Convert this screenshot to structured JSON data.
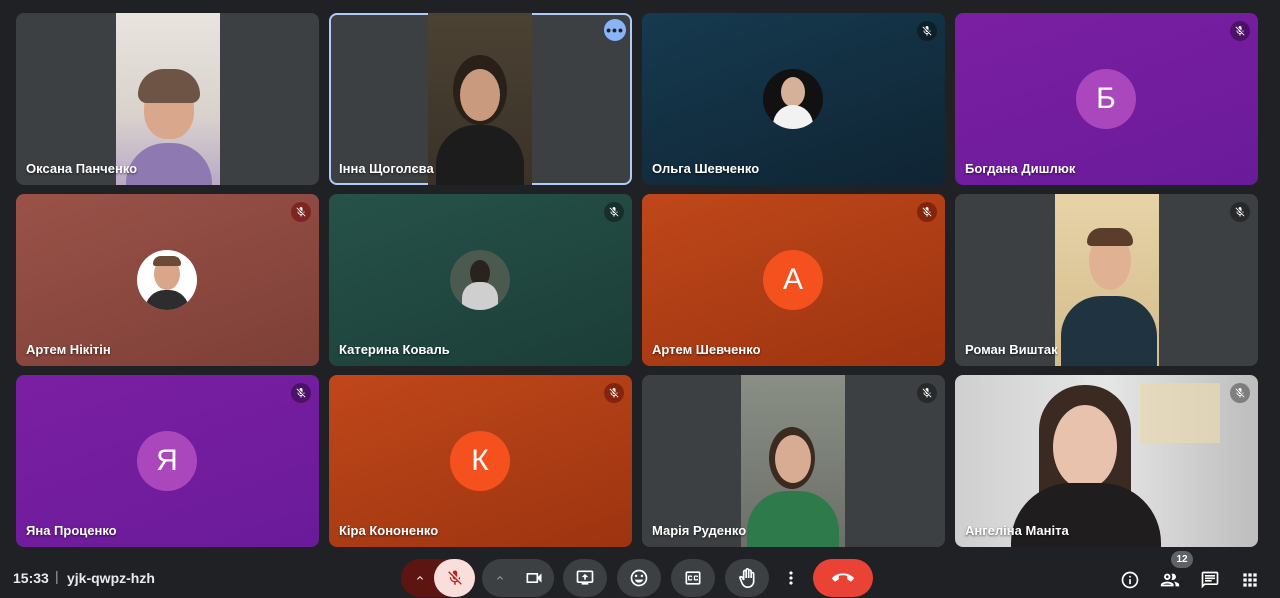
{
  "meeting": {
    "time": "15:33",
    "separator": "|",
    "code": "yjk-qwpz-hzh",
    "participants_count": "12"
  },
  "participants": [
    {
      "name": "Оксана Панченко",
      "kind": "video",
      "muted": false,
      "bg": "#3c4043"
    },
    {
      "name": "Інна Щоголєва",
      "kind": "video",
      "muted": false,
      "bg": "#3c4043",
      "active": true
    },
    {
      "name": "Ольга Шевченко",
      "kind": "photo",
      "muted": true,
      "bg": "#123043"
    },
    {
      "name": "Богдана Дишлюк",
      "kind": "letter",
      "letter": "Б",
      "muted": true,
      "bg": "#7b1fa2",
      "avatar_color": "#ab47bc"
    },
    {
      "name": "Артем Нікітін",
      "kind": "photo",
      "muted": true,
      "bg": "#8d4a43"
    },
    {
      "name": "Катерина Коваль",
      "kind": "photo",
      "muted": true,
      "bg": "#234a43"
    },
    {
      "name": "Артем Шевченко",
      "kind": "letter",
      "letter": "А",
      "muted": true,
      "bg": "#bf4012",
      "avatar_color": "#f4511e"
    },
    {
      "name": "Роман Виштак",
      "kind": "video",
      "muted": true,
      "bg": "#3c4043"
    },
    {
      "name": "Яна Проценко",
      "kind": "letter",
      "letter": "Я",
      "muted": true,
      "bg": "#7b1fa2",
      "avatar_color": "#ab47bc"
    },
    {
      "name": "Кіра Кононенко",
      "kind": "letter",
      "letter": "К",
      "muted": true,
      "bg": "#bf4012",
      "avatar_color": "#f4511e"
    },
    {
      "name": "Марія Руденко",
      "kind": "video",
      "muted": true,
      "bg": "#3c4043"
    },
    {
      "name": "Ангеліна Маніта",
      "kind": "video",
      "muted": true,
      "bg": "#3c4043"
    }
  ],
  "controls": {
    "mic_options": "chevron-up-icon",
    "mic": "mic-off-icon",
    "camera_options": "chevron-up-icon",
    "camera": "camera-icon",
    "present": "present-screen-icon",
    "emoji": "emoji-icon",
    "captions": "captions-icon",
    "raise_hand": "hand-icon",
    "more": "more-vert-icon",
    "leave": "call-end-icon",
    "info": "info-icon",
    "people": "people-icon",
    "chat": "chat-icon",
    "activities": "apps-icon"
  },
  "colors": {
    "leave": "#ea4335",
    "mic_off_bg": "#f9dedc",
    "active_border": "#aecbfa"
  }
}
